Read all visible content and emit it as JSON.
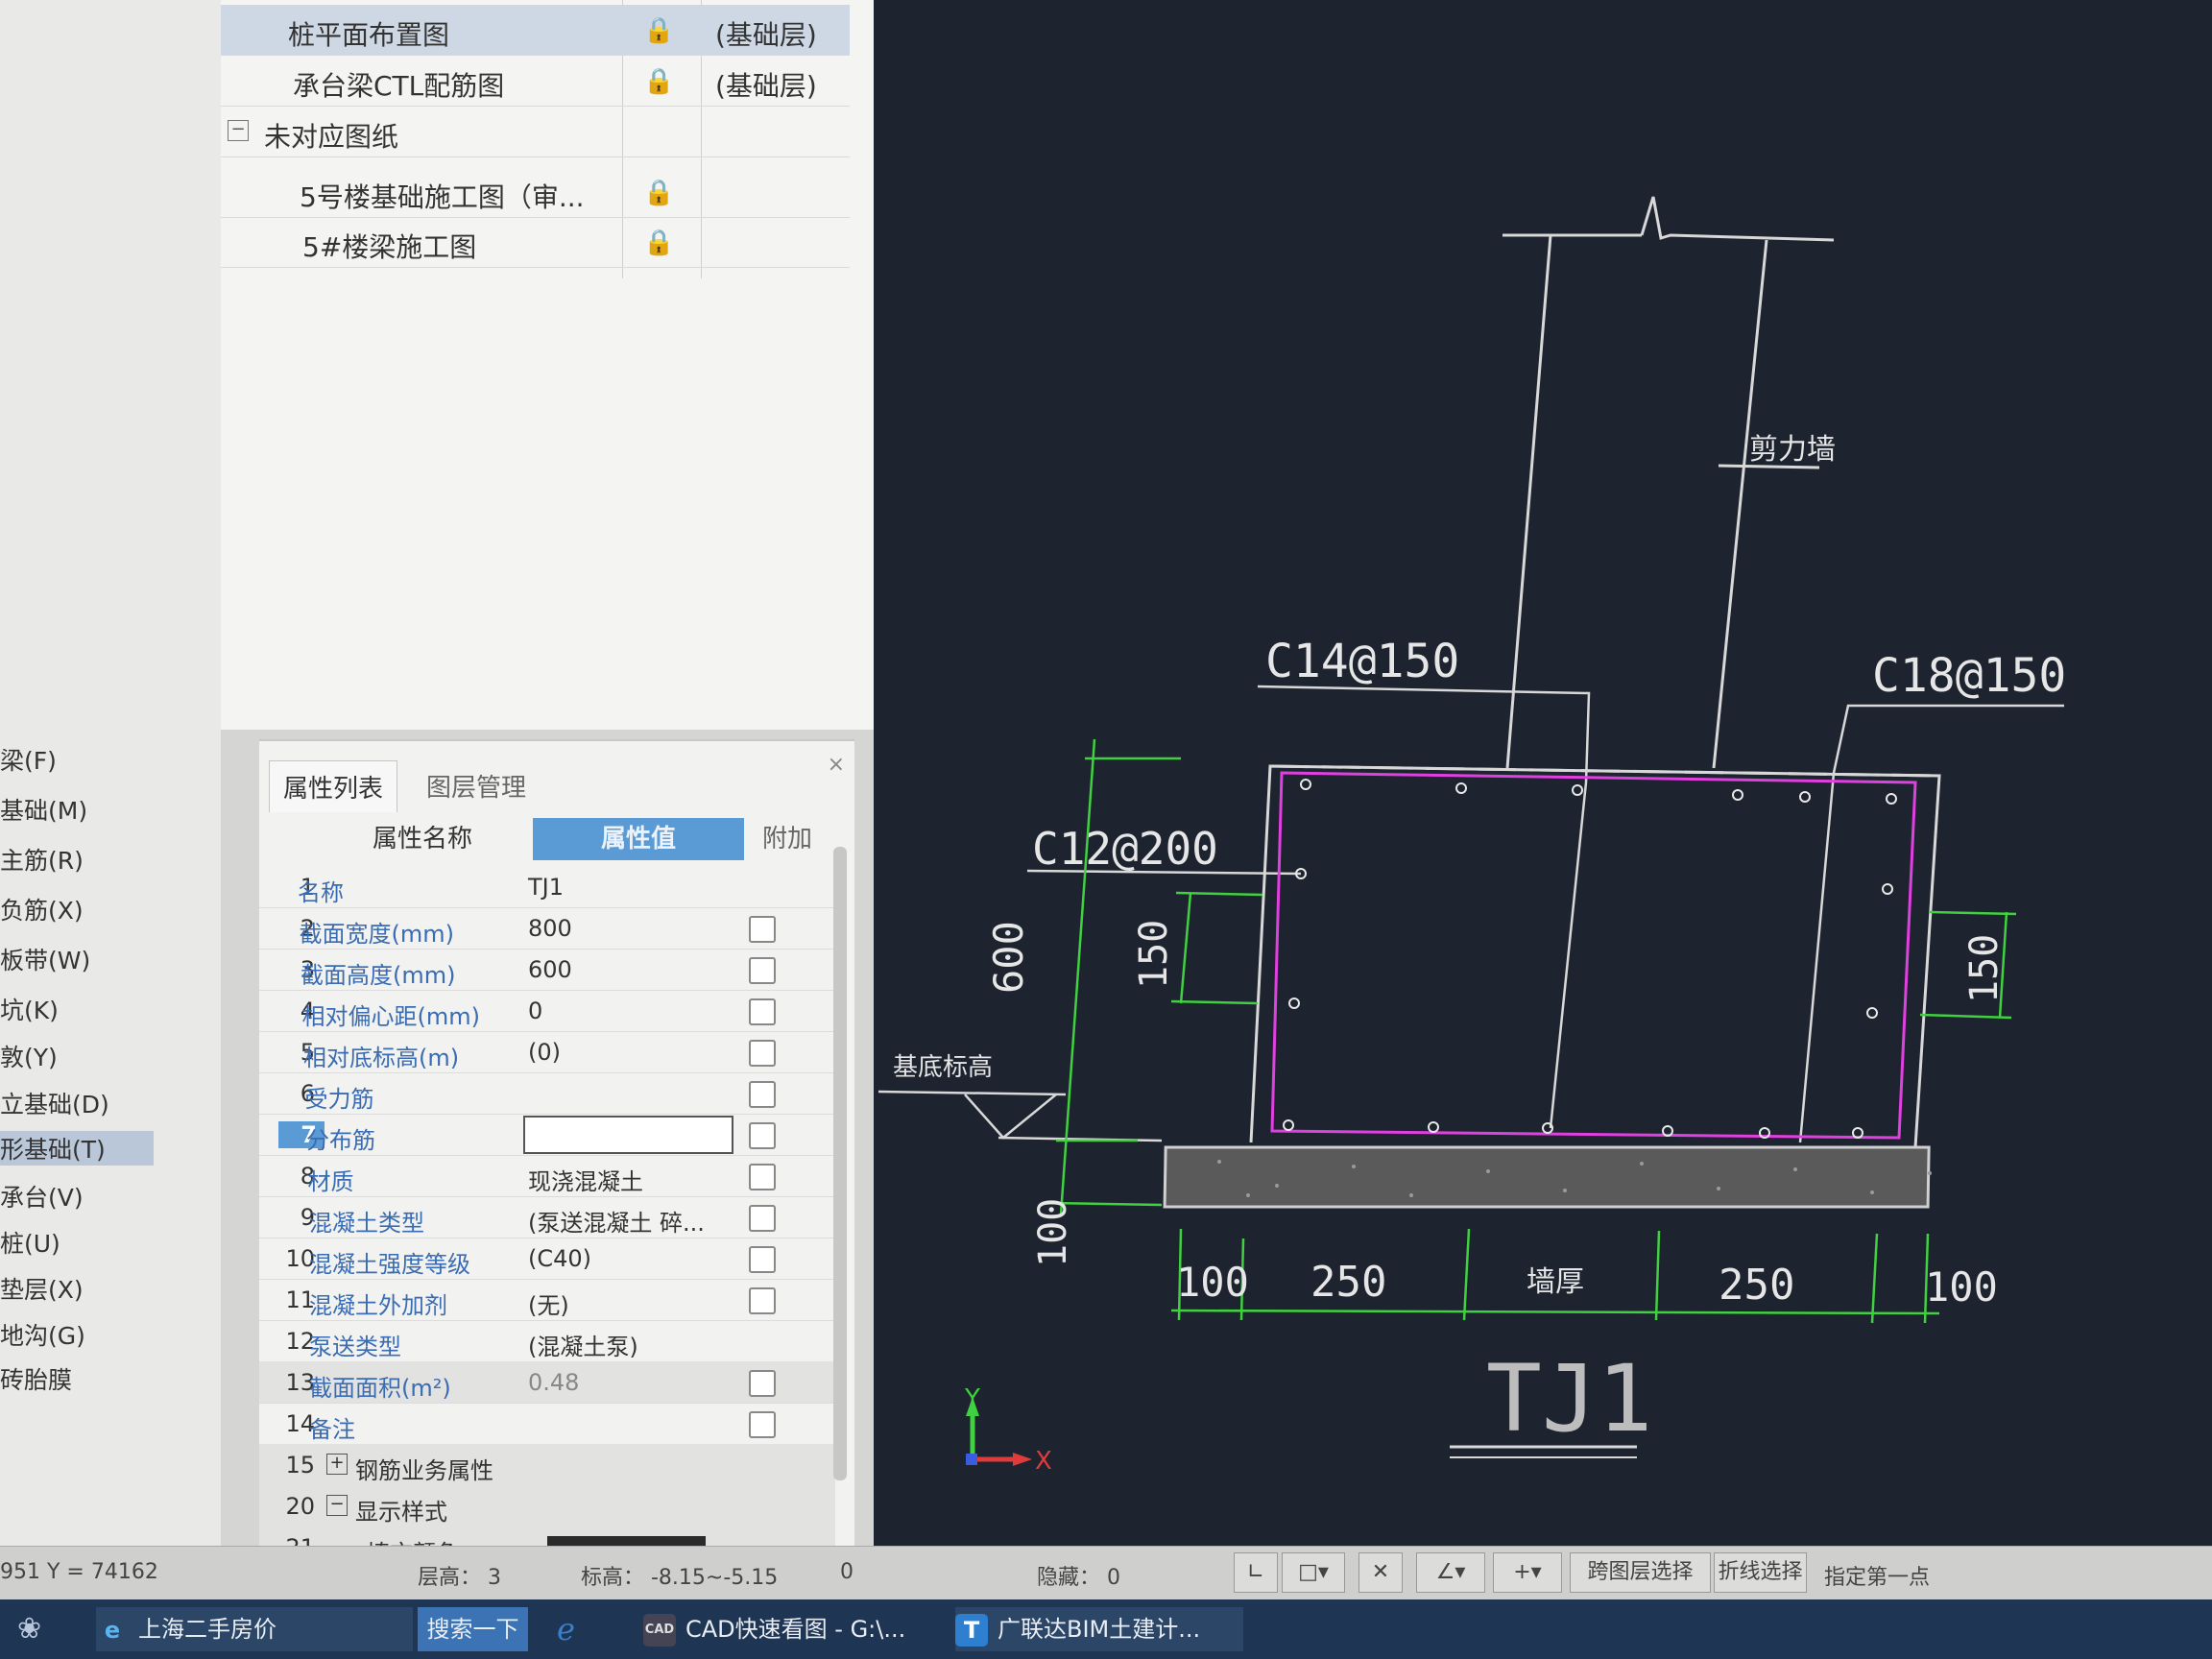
{
  "categories": [
    "梁(F)",
    "基础(M)",
    "主筋(R)",
    "负筋(X)",
    "板带(W)",
    "坑(K)",
    "敦(Y)",
    "立基础(D)",
    "形基础(T)",
    "承台(V)",
    "桩(U)",
    "垫层(X)",
    "地沟(G)",
    "砖胎膜"
  ],
  "selected_category": "形基础(T)",
  "drawing_tree": {
    "rows": [
      {
        "label": "桩平面布置图",
        "lock": "🔒",
        "layer": "(基础层)",
        "selected": true
      },
      {
        "label": "承台梁CTL配筋图",
        "lock": "🔒",
        "layer": "(基础层)"
      },
      {
        "label": "未对应图纸",
        "collapse": "−"
      },
      {
        "label": "5号楼基础施工图（审...",
        "lock": "🔒",
        "layer": ""
      },
      {
        "label": "5#楼梁施工图",
        "lock": "🔒",
        "layer": ""
      }
    ]
  },
  "properties": {
    "tabs": [
      "属性列表",
      "图层管理"
    ],
    "close": "×",
    "headers": {
      "name": "属性名称",
      "value": "属性值",
      "extra": "附加"
    },
    "rows": [
      {
        "num": "1",
        "name": "名称",
        "value": "TJ1"
      },
      {
        "num": "2",
        "name": "截面宽度(mm)",
        "value": "800"
      },
      {
        "num": "3",
        "name": "截面高度(mm)",
        "value": "600"
      },
      {
        "num": "4",
        "name": "相对偏心距(mm)",
        "value": "0"
      },
      {
        "num": "5",
        "name": "相对底标高(m)",
        "value": "(0)"
      },
      {
        "num": "6",
        "name": "受力筋",
        "value": ""
      },
      {
        "num": "7",
        "name": "分布筋",
        "value": ""
      },
      {
        "num": "8",
        "name": "材质",
        "value": "现浇混凝土"
      },
      {
        "num": "9",
        "name": "混凝土类型",
        "value": "(泵送混凝土 碎..."
      },
      {
        "num": "10",
        "name": "混凝土强度等级",
        "value": "(C40)"
      },
      {
        "num": "11",
        "name": "混凝土外加剂",
        "value": "(无)"
      },
      {
        "num": "12",
        "name": "泵送类型",
        "value": "(混凝土泵)"
      },
      {
        "num": "13",
        "name": "截面面积(m²)",
        "value": "0.48"
      },
      {
        "num": "14",
        "name": "备注",
        "value": ""
      },
      {
        "num": "15",
        "name": "钢筋业务属性",
        "value": "",
        "expander": "+"
      },
      {
        "num": "20",
        "name": "显示样式",
        "value": "",
        "expander": "−"
      },
      {
        "num": "21",
        "name": "填充颜色",
        "value": ""
      }
    ]
  },
  "cad": {
    "labels": {
      "rebar_top_left": "C14@150",
      "rebar_top_right": "C18@150",
      "rebar_side": "C12@200",
      "wall": "剪力墙",
      "base_level": "基底标高",
      "dim_600": "600",
      "dim_150_left": "150",
      "dim_150_right": "150",
      "dim_100_v": "100",
      "dim_100_left": "100",
      "dim_250_left": "250",
      "dim_wall_width": "墙厚",
      "dim_250_right": "250",
      "dim_100_right": "100",
      "title": "TJ1",
      "axis_y": "Y",
      "axis_x": "X"
    }
  },
  "status": {
    "coord": "951 Y = 74162",
    "floor_height": "层高：  3",
    "elevation": "标高：  -8.15~-5.15",
    "zero": "0",
    "hidden": "隐藏：  0",
    "buttons": [
      "跨图层选择",
      "折线选择",
      "指定第一点"
    ]
  },
  "taskbar": {
    "items": [
      {
        "label": "上海二手房价",
        "icon": "e"
      },
      {
        "label": "搜索一下",
        "icon": ""
      },
      {
        "label": "CAD快速看图 - G:\\...",
        "icon": "CAD"
      },
      {
        "label": "广联达BIM土建计...",
        "icon": "T"
      }
    ]
  },
  "colors": {
    "cad_bg": "#1d2430",
    "accent": "#5b9bd5",
    "rebar": "#e040e0",
    "dim": "#40d040"
  }
}
